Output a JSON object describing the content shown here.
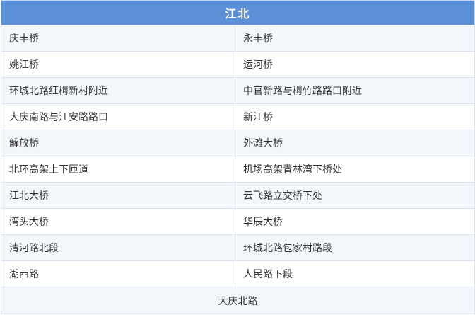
{
  "table": {
    "header": "江北",
    "rows": [
      [
        "庆丰桥",
        "永丰桥"
      ],
      [
        "姚江桥",
        "运河桥"
      ],
      [
        "环城北路红梅新村附近",
        "中官新路与梅竹路路口附近"
      ],
      [
        "大庆南路与江安路路口",
        "新江桥"
      ],
      [
        "解放桥",
        "外滩大桥"
      ],
      [
        "北环高架上下匝道",
        "机场高架青林湾下桥处"
      ],
      [
        "江北大桥",
        "云飞路立交桥下处"
      ],
      [
        "湾头大桥",
        "华辰大桥"
      ],
      [
        "清河路北段",
        "环城北路包家村路段"
      ],
      [
        "湖西路",
        "人民路下段"
      ]
    ],
    "footer": "大庆北路"
  }
}
